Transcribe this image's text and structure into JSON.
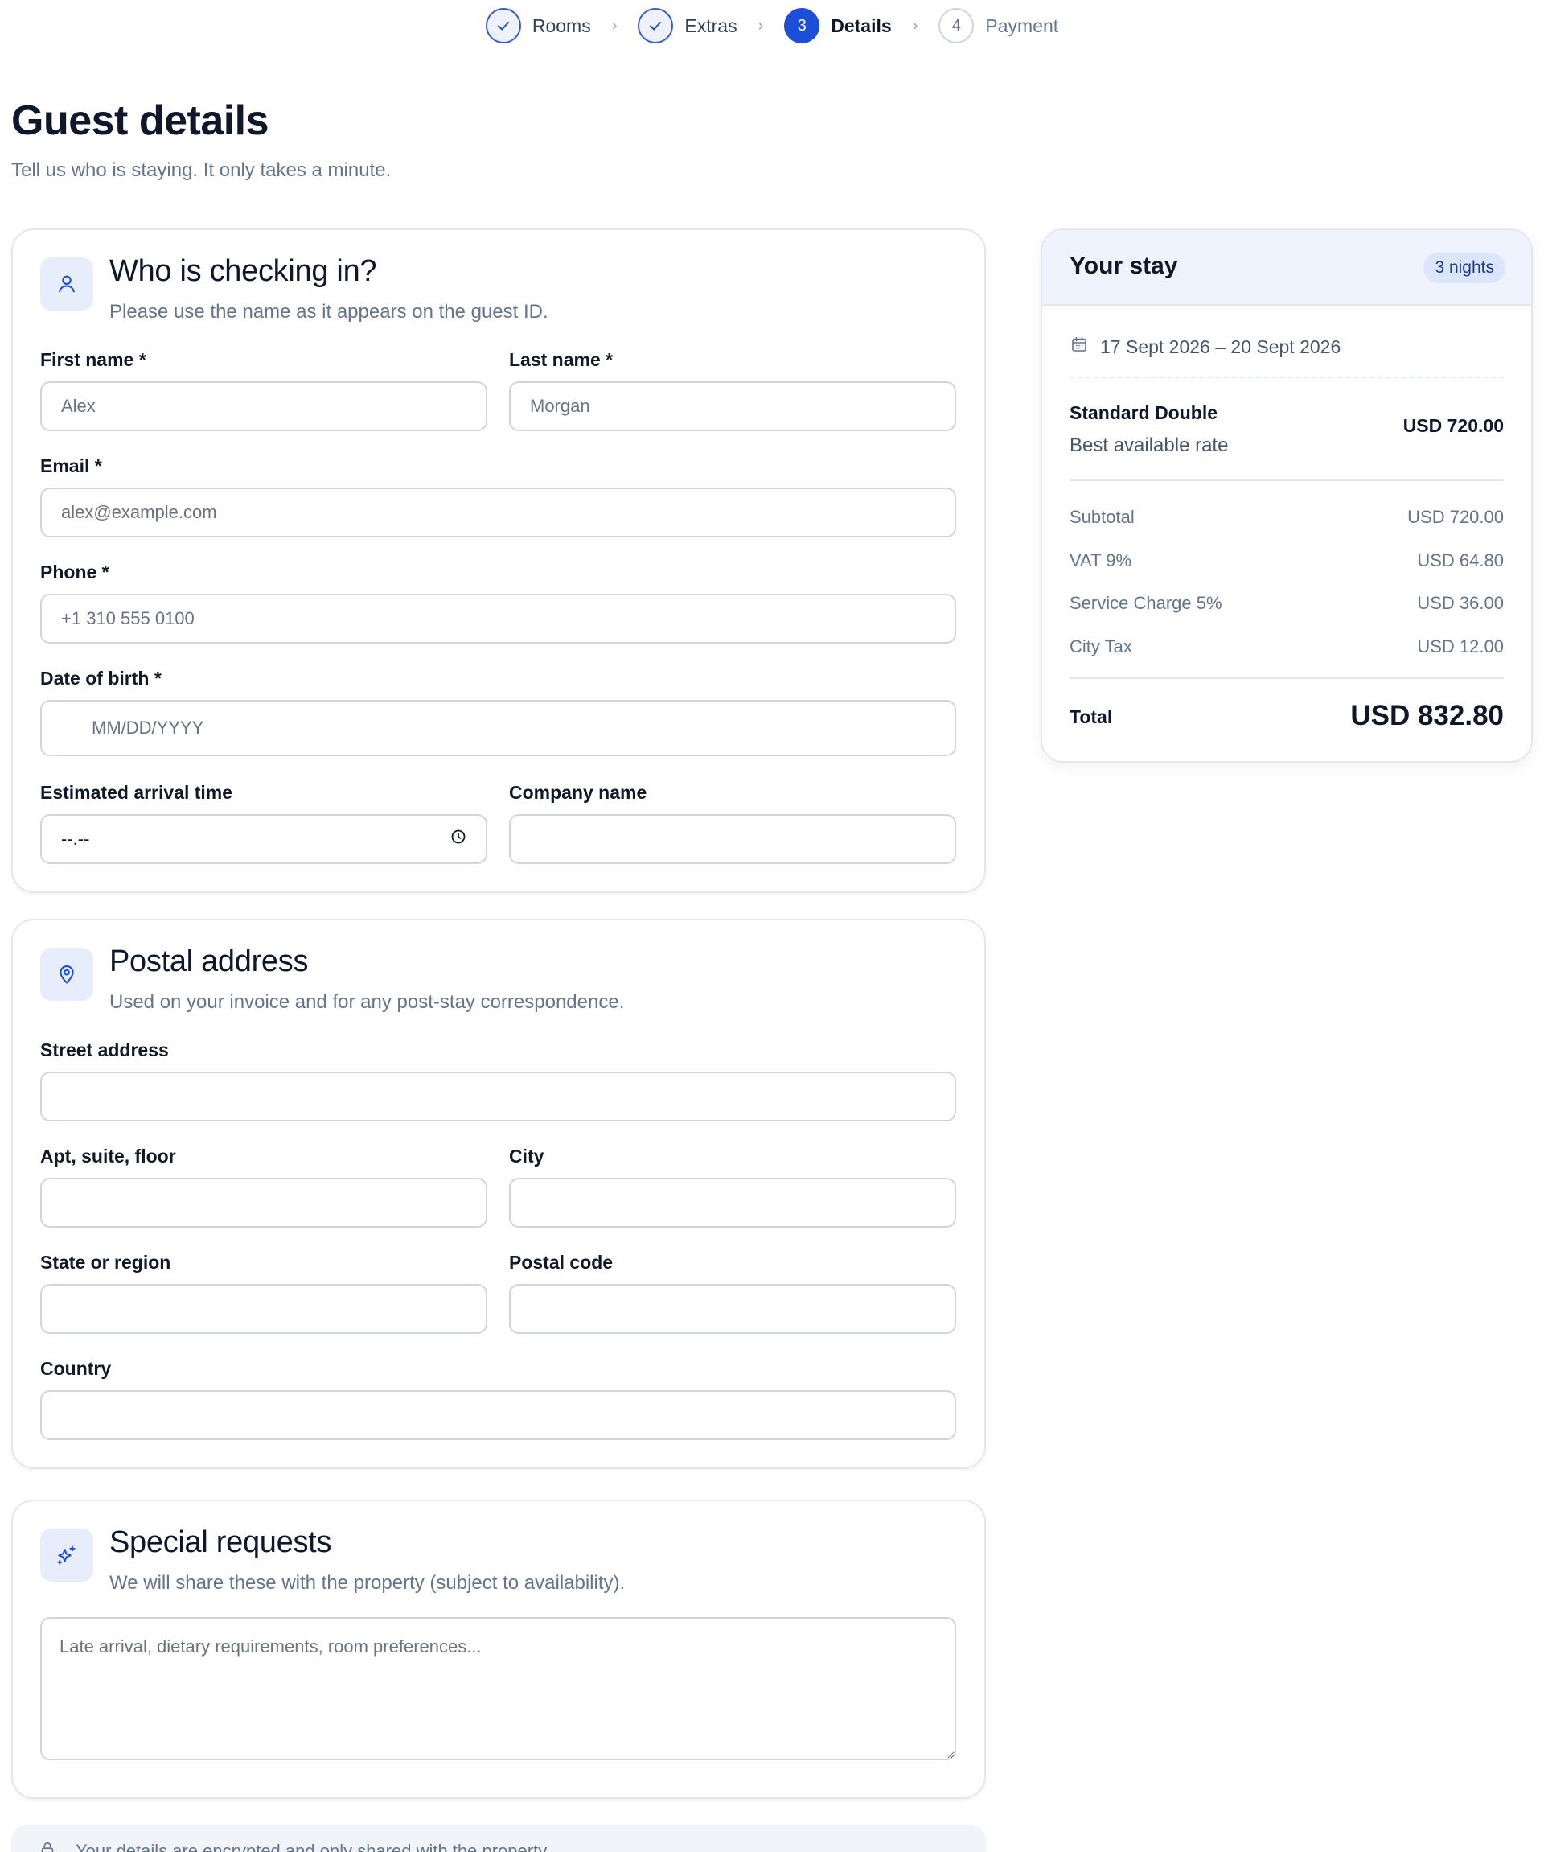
{
  "stepper": {
    "steps": [
      {
        "label": "Rooms",
        "state": "done",
        "number": ""
      },
      {
        "label": "Extras",
        "state": "done",
        "number": ""
      },
      {
        "label": "Details",
        "state": "active",
        "number": "3"
      },
      {
        "label": "Payment",
        "state": "todo",
        "number": "4"
      }
    ]
  },
  "header": {
    "title": "Guest details",
    "subtitle": "Tell us who is staying. It only takes a minute."
  },
  "guest": {
    "title": "Who is checking in?",
    "description": "Please use the name as it appears on the guest ID.",
    "first_name_label": "First name *",
    "first_name_placeholder": "Alex",
    "last_name_label": "Last name *",
    "last_name_placeholder": "Morgan",
    "email_label": "Email *",
    "email_placeholder": "alex@example.com",
    "phone_label": "Phone *",
    "phone_placeholder": "+1 310 555 0100",
    "dob_label": "Date of birth *",
    "dob_placeholder": "MM/DD/YYYY",
    "arrival_label": "Estimated arrival time",
    "arrival_value": "--.--",
    "company_label": "Company name"
  },
  "address": {
    "title": "Postal address",
    "description": "Used on your invoice and for any post-stay correspondence.",
    "street_label": "Street address",
    "apt_label": "Apt, suite, floor",
    "city_label": "City",
    "state_label": "State or region",
    "postal_label": "Postal code",
    "country_label": "Country"
  },
  "requests": {
    "title": "Special requests",
    "description": "We will share these with the property (subject to availability).",
    "placeholder": "Late arrival, dietary requirements, room preferences..."
  },
  "summary": {
    "title": "Your stay",
    "nights_badge": "3 nights",
    "dates": "17 Sept 2026 – 20 Sept 2026",
    "room_name": "Standard Double",
    "room_rate": "Best available rate",
    "room_price": "USD 720.00",
    "fees": [
      {
        "label": "Subtotal",
        "value": "USD 720.00"
      },
      {
        "label": "VAT 9%",
        "value": "USD 64.80"
      },
      {
        "label": "Service Charge 5%",
        "value": "USD 36.00"
      },
      {
        "label": "City Tax",
        "value": "USD 12.00"
      }
    ],
    "total_label": "Total",
    "total_value": "USD 832.80"
  },
  "notice": {
    "text": "Your details are encrypted and only shared with the property."
  },
  "icons": {
    "guest": "user-icon",
    "address": "map-pin-icon",
    "requests": "sparkles-icon",
    "dates": "calendar-icon",
    "time": "clock-icon",
    "check": "check-icon"
  },
  "colors": {
    "accent": "#1d4ed8",
    "accent_soft": "#e8edfc",
    "muted_text": "#64748b"
  }
}
